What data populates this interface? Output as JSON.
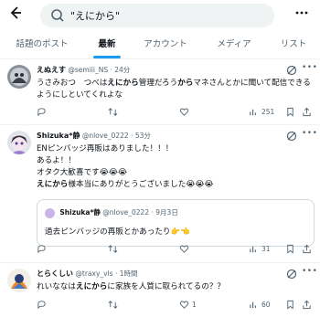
{
  "search": {
    "value": "\"えにから\""
  },
  "tabs": [
    {
      "label": "話題のポスト"
    },
    {
      "label": "最新"
    },
    {
      "label": "アカウント"
    },
    {
      "label": "メディア"
    },
    {
      "label": "リスト"
    }
  ],
  "tweets": [
    {
      "display_name": "えぬえす",
      "handle": "@semiii_NS",
      "sep": "·",
      "time": "24分",
      "text_parts": [
        "うさみおつ　つべは",
        "えにから",
        "管理だろう",
        "から",
        "マネさんとかに聞いて配信できるようにしといてくれよな"
      ],
      "counts": {
        "reply": "",
        "retweet": "",
        "like": "",
        "views": "251"
      }
    },
    {
      "display_name": "Shizuka*静",
      "handle": "@nlove_0222",
      "sep": "·",
      "time": "53分",
      "lines": [
        "ENピンバッジ再販はありました！！！",
        "あるよ！！",
        "オタク大歓喜です😭😭😭"
      ],
      "line4_parts": [
        "えにから",
        "様本当にありがとうございました😭😭😭"
      ],
      "quote": {
        "display_name": "Shizuka*静",
        "handle": "@nlove_0222",
        "sep": "·",
        "date": "9月3日",
        "text": "過去ピンバッジの再販とかあったり👉👈"
      },
      "counts": {
        "reply": "",
        "retweet": "",
        "like": "",
        "views": "31"
      }
    },
    {
      "display_name": "とらくしい",
      "handle": "@traxy_vls",
      "sep": "·",
      "time": "1時間",
      "text_parts": [
        "れいななは",
        "えにから",
        "に家族を人質に取られてるの？？"
      ],
      "counts": {
        "reply": "",
        "retweet": "",
        "like": "1",
        "views": "60"
      }
    }
  ]
}
